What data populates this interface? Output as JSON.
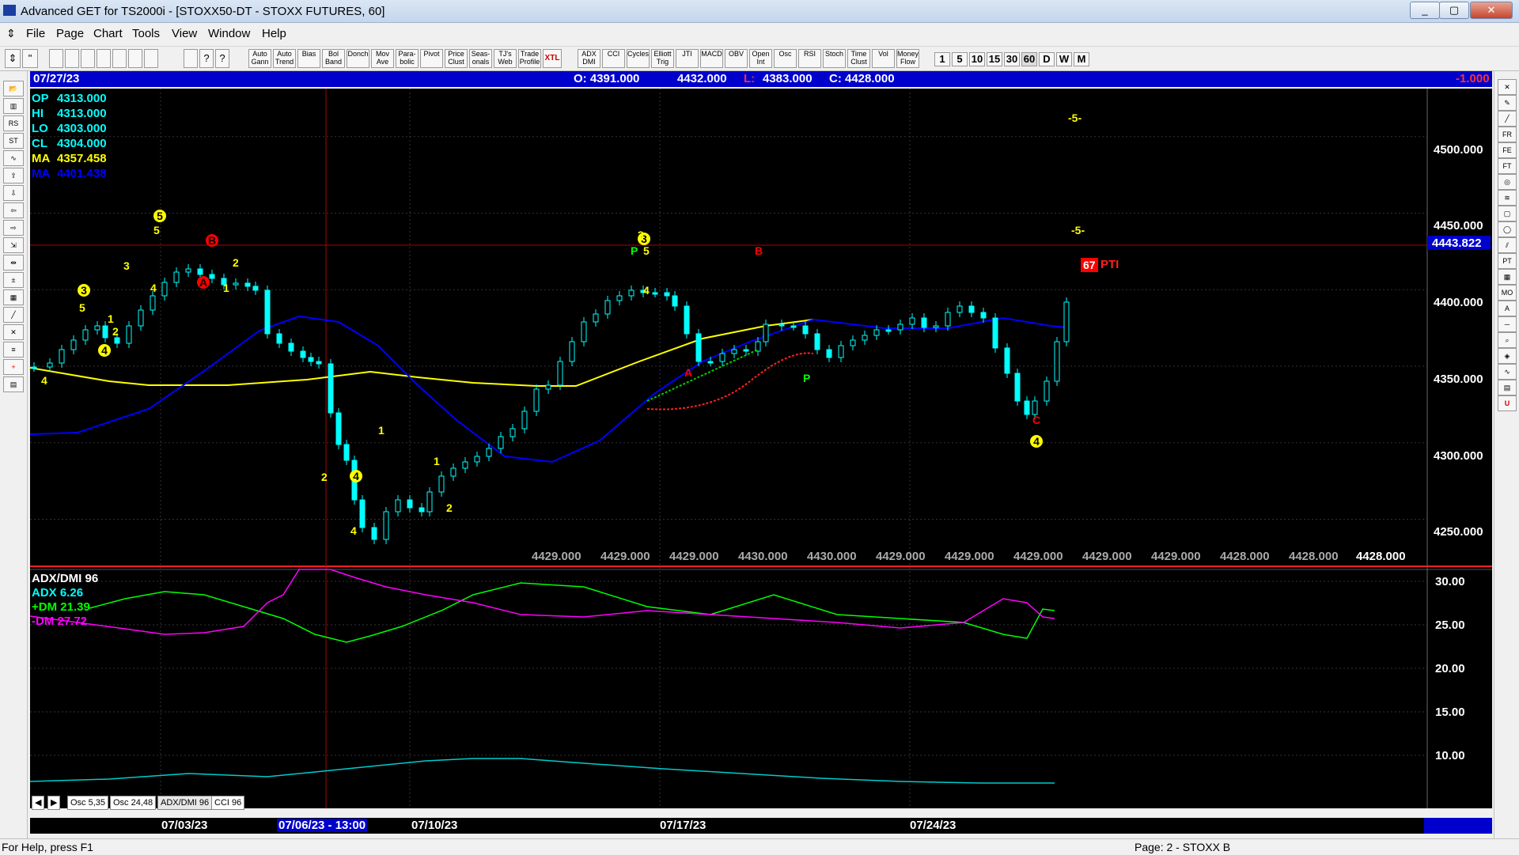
{
  "window": {
    "title": "Advanced GET for TS2000i - [STOXX50-DT - STOXX FUTURES, 60]"
  },
  "menu": [
    "File",
    "Page",
    "Chart",
    "Tools",
    "View",
    "Window",
    "Help"
  ],
  "toolbar": {
    "buttons": [
      "Auto Gann",
      "Auto Trend",
      "Bias",
      "Bol Band",
      "Donch",
      "Mov Ave",
      "Para-bolic",
      "Pivot",
      "Price Clust",
      "Seas-onals",
      "TJ's Web",
      "Trade Profile",
      "XTL",
      "ADX DMI",
      "CCI",
      "Cycles",
      "Elliott Trig",
      "JTI",
      "MACD",
      "OBV",
      "Open Int",
      "Osc",
      "RSI",
      "Stoch",
      "Time Clust",
      "Vol",
      "Money Flow"
    ],
    "periods": [
      "1",
      "5",
      "10",
      "15",
      "30",
      "60",
      "D",
      "W",
      "M"
    ]
  },
  "infobar": {
    "date": "07/27/23",
    "open": "O: 4391.000",
    "high": "4432.000",
    "low_label": "L:",
    "low": "4383.000",
    "close": "C: 4428.000",
    "change": "-1.000"
  },
  "price_panel": {
    "readouts": [
      {
        "label": "OP",
        "value": "4313.000",
        "color": "#00ffff"
      },
      {
        "label": "HI",
        "value": "4313.000",
        "color": "#00ffff"
      },
      {
        "label": "LO",
        "value": "4303.000",
        "color": "#00ffff"
      },
      {
        "label": "CL",
        "value": "4304.000",
        "color": "#00ffff"
      },
      {
        "label": "MA",
        "value": "4357.458",
        "color": "#ffff00"
      },
      {
        "label": "MA",
        "value": "4401.438",
        "color": "#0000ff"
      }
    ],
    "y_ticks": [
      "4500.000",
      "4450.000",
      "4400.000",
      "4350.000",
      "4300.000",
      "4250.000"
    ],
    "current_price": "4443.822",
    "pti": {
      "value": "67",
      "label": "PTI"
    },
    "targets": [
      "-5-",
      "-5-"
    ],
    "bottom_values": [
      "4429.000",
      "4429.000",
      "4429.000",
      "4430.000",
      "4430.000",
      "4429.000",
      "4429.000",
      "4429.000",
      "4429.000",
      "4429.000",
      "4428.000",
      "4428.000",
      "4428.000"
    ],
    "wave_labels": [
      "4",
      "3",
      "5",
      "1",
      "2",
      "4",
      "3",
      "5",
      "5",
      "4",
      "B",
      "A",
      "2",
      "1",
      "3",
      "4",
      "2",
      "1",
      "4",
      "1",
      "2",
      "3",
      "3",
      "P",
      "5",
      "4",
      "B",
      "A",
      "P",
      "C",
      "4"
    ]
  },
  "indicator_panel": {
    "title": "ADX/DMI 96",
    "adx": "ADX 6.26",
    "pdm": "+DM 21.39",
    "mdm": "-DM 27.72",
    "y_ticks": [
      "30.00",
      "25.00",
      "20.00",
      "15.00",
      "10.00"
    ]
  },
  "tabs": [
    "Osc 5,35",
    "Osc 24,48",
    "ADX/DMI 96",
    "CCI 96"
  ],
  "dates": [
    "07/03/23",
    "07/06/23 - 13:00",
    "07/10/23",
    "07/17/23",
    "07/24/23"
  ],
  "status": {
    "help": "For Help, press F1",
    "page": "Page: 2 - STOXX B"
  },
  "colors": {
    "background": "#000000",
    "ma_fast": "#ffff00",
    "ma_slow": "#0000ff",
    "candles": "#00ffff",
    "pdm": "#00ff00",
    "mdm": "#ff00ff",
    "adx": "#00cccc",
    "infobar": "#0000cc"
  }
}
